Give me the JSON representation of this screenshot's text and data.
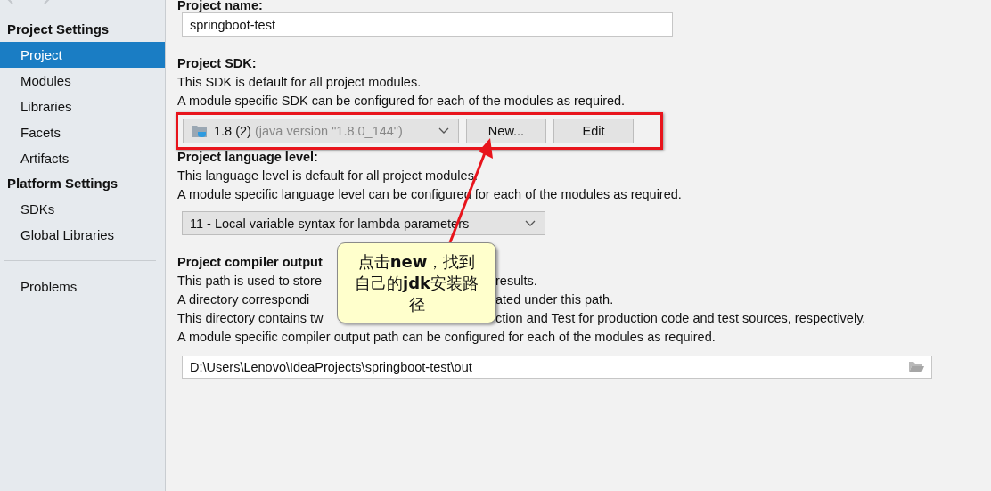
{
  "sidebar": {
    "groups": [
      {
        "title": "Project Settings",
        "items": [
          {
            "label": "Project",
            "selected": true
          },
          {
            "label": "Modules",
            "selected": false
          },
          {
            "label": "Libraries",
            "selected": false
          },
          {
            "label": "Facets",
            "selected": false
          },
          {
            "label": "Artifacts",
            "selected": false
          }
        ]
      },
      {
        "title": "Platform Settings",
        "items": [
          {
            "label": "SDKs",
            "selected": false
          },
          {
            "label": "Global Libraries",
            "selected": false
          }
        ]
      }
    ],
    "bottom_items": [
      {
        "label": "Problems",
        "selected": false
      }
    ]
  },
  "project_name": {
    "label": "Project name:",
    "value": "springboot-test"
  },
  "project_sdk": {
    "label": "Project SDK:",
    "lines": [
      "This SDK is default for all project modules.",
      "A module specific SDK can be configured for each of the modules as required."
    ],
    "combo": {
      "value": "1.8 (2)",
      "detail": "(java version \"1.8.0_144\")"
    },
    "buttons": [
      "New...",
      "Edit"
    ]
  },
  "language_level": {
    "label": "Project language level:",
    "lines": [
      "This language level is default for all project modules.",
      "A module specific language level can be configured for each of the modules as required."
    ],
    "combo": {
      "value": "11 - Local variable syntax for lambda parameters"
    }
  },
  "compiler_output": {
    "label": "Project compiler output",
    "lines": [
      {
        "parts": [
          "This path is used to store",
          "results."
        ]
      },
      {
        "parts": [
          "A directory correspondi",
          "ated under this path."
        ]
      },
      {
        "parts": [
          "This directory contains tw",
          "ction and Test for production code and test sources, respectively."
        ]
      },
      {
        "parts": [
          "A module specific compiler output path can be configured for each of the modules as required."
        ]
      }
    ],
    "path": "D:\\Users\\Lenovo\\IdeaProjects\\springboot-test\\out"
  },
  "callout": {
    "text": "点击**new**，找到自己的**jdk**安装路径"
  }
}
